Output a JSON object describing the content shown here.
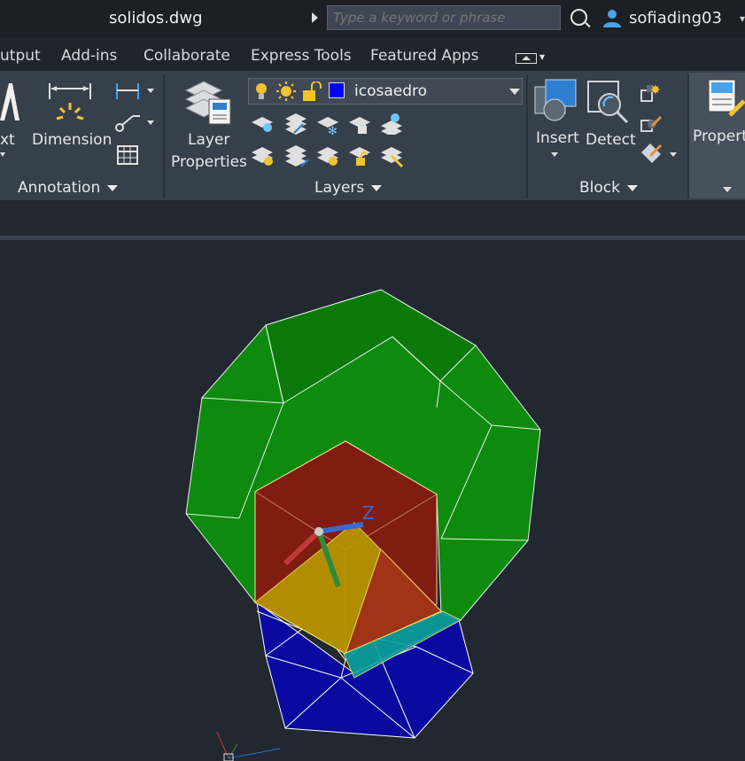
{
  "titlebar": {
    "title": "solidos.dwg",
    "search_placeholder": "Type a keyword or phrase",
    "username": "sofiading03"
  },
  "tabs": [
    "utput",
    "Add-ins",
    "Collaborate",
    "Express Tools",
    "Featured Apps"
  ],
  "ribbon": {
    "annotation": {
      "text_label": "xt",
      "dimension_label": "Dimension",
      "panel_title": "Annotation"
    },
    "layers": {
      "layer_properties_line1": "Layer",
      "layer_properties_line2": "Properties",
      "current_layer": "icosaedro",
      "current_layer_color": "#0000ff",
      "panel_title": "Layers"
    },
    "block": {
      "insert_label": "Insert",
      "detect_label": "Detect",
      "panel_title": "Block"
    },
    "properties": {
      "label": "Propert"
    }
  },
  "viewport": {
    "ucs_z_label": "Z"
  }
}
